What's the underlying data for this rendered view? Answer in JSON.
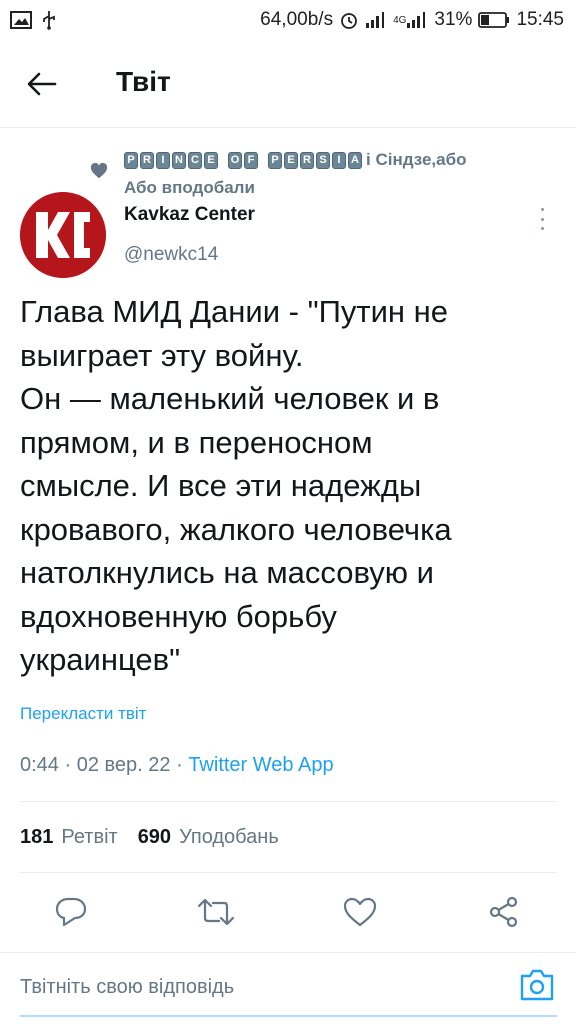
{
  "status_bar": {
    "speed": "64,00b/s",
    "network": "4G",
    "battery": "31%",
    "time": "15:45"
  },
  "header": {
    "title": "Твіт"
  },
  "social_context": {
    "boxed_word_1": [
      "P",
      "R",
      "I",
      "N",
      "C",
      "E"
    ],
    "boxed_word_2": [
      "O",
      "F"
    ],
    "boxed_word_3": [
      "P",
      "E",
      "R",
      "S",
      "I",
      "A"
    ],
    "suffix": "і Сіндзе,або",
    "line2": "Або вподобали"
  },
  "author": {
    "name": "Kavkaz Center",
    "handle": "@newkc14",
    "avatar_text": "KC",
    "avatar_color": "#b5161b"
  },
  "tweet": {
    "text": "Глава МИД Дании - \"Путин не\nвыиграет эту войну.\nОн — маленький человек и в\nпрямом, и в переносном\nсмысле. И все эти надежды\nкровавого, жалкого человечка\nнатолкнулись на массовую и\nвдохновенную борьбу\nукраинцев\"",
    "translate_label": "Перекласти твіт",
    "time": "0:44",
    "date": "02 вер. 22",
    "source": "Twitter Web App"
  },
  "stats": {
    "retweets_count": "181",
    "retweets_label": "Ретвіт",
    "likes_count": "690",
    "likes_label": "Уподобань"
  },
  "actions": {
    "icons": [
      "reply-icon",
      "retweet-icon",
      "like-icon",
      "share-icon"
    ]
  },
  "reply_bar": {
    "placeholder": "Твітніть свою відповідь"
  },
  "colors": {
    "accent": "#1da1f2",
    "secondary_text": "#657786",
    "primary_text": "#14171a",
    "divider": "#e6ecf0"
  }
}
